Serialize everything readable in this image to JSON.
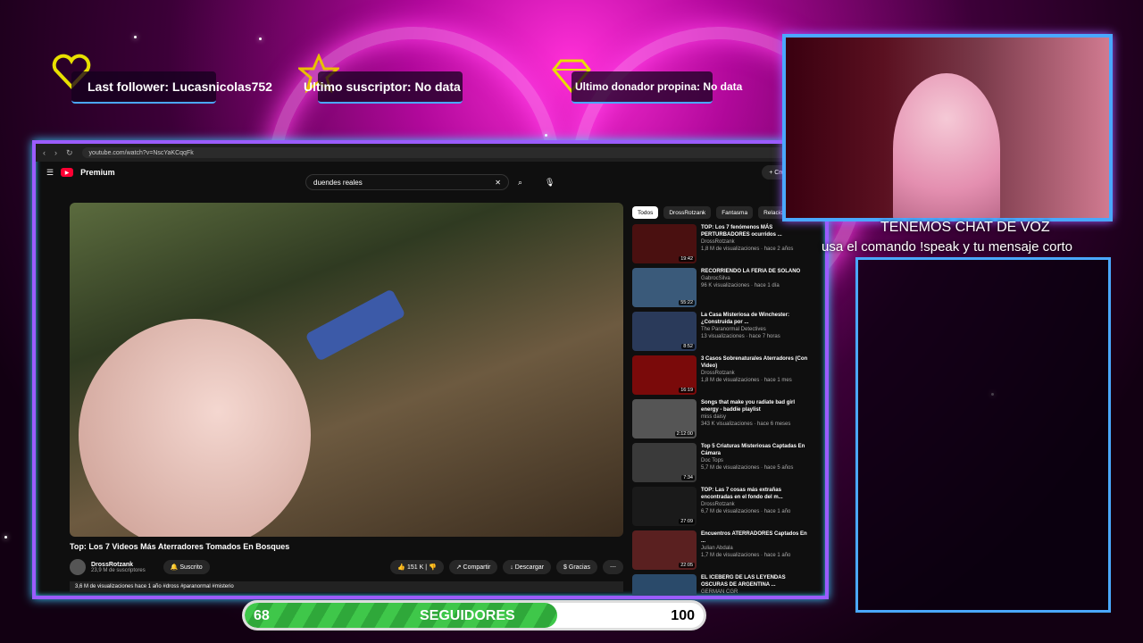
{
  "overlay": {
    "last_follower": "Last follower: Lucasnicolas752",
    "last_subscriber": "Ultimo suscriptor: No data",
    "last_donor": "Ultimo donador propina: No data",
    "voice_chat_title": "TENEMOS CHAT DE VOZ",
    "voice_chat_sub": "usa el comando !speak y tu mensaje corto",
    "followers_current": "68",
    "followers_label": "SEGUIDORES",
    "followers_goal": "100",
    "followers_progress": 0.68
  },
  "browser": {
    "url": "youtube.com/watch?v=NscYaKCqqFk",
    "create_label": "Crear"
  },
  "youtube": {
    "brand": "Premium",
    "search_value": "duendes reales",
    "video_title": "Top: Los 7 Videos Más Aterradores Tomados En Bosques",
    "channel": "DrossRotzank",
    "subscribers": "23,9 M de suscriptores",
    "subscribe_label": "Suscrito",
    "likes": "151 K",
    "share": "Compartir",
    "download": "Descargar",
    "thanks": "Gracias",
    "description": "3,6 M de visualizaciones  hace 1 año  #dross #paranormal #misterio",
    "chips": [
      "Todos",
      "DrossRotzank",
      "Fantasma",
      "Relacio"
    ],
    "recs": [
      {
        "title": "TOP: Los 7 fenómenos MÁS PERTURBADORES ocurridos ...",
        "channel": "DrossRotzank",
        "meta": "1,8 M de visualizaciones · hace 2 años",
        "dur": "19:42",
        "color": "#4a1010"
      },
      {
        "title": "RECORRIENDO LA FERIA DE SOLANO",
        "channel": "GabrocSilva",
        "meta": "96 K visualizaciones · hace 1 día",
        "dur": "55:22",
        "color": "#3a5a7a"
      },
      {
        "title": "La Casa Misteriosa de Winchester: ¿Construida por ...",
        "channel": "The Paranormal Detectives",
        "meta": "13 visualizaciones · hace 7 horas",
        "dur": "8:52",
        "color": "#2a3a5a"
      },
      {
        "title": "3 Casos Sobrenaturales Aterradores (Con Video)",
        "channel": "DrossRotzank",
        "meta": "1,8 M de visualizaciones · hace 1 mes",
        "dur": "16:19",
        "color": "#7a0a0a"
      },
      {
        "title": "Songs that make you radiate bad girl energy - baddie playlist",
        "channel": "miss daisy",
        "meta": "343 K visualizaciones · hace 6 meses",
        "dur": "2:12:00",
        "color": "#555"
      },
      {
        "title": "Top 5 Criaturas Misteriosas Captadas En Cámara",
        "channel": "Doc Tops",
        "meta": "5,7 M de visualizaciones · hace 5 años",
        "dur": "7:34",
        "color": "#3a3a3a"
      },
      {
        "title": "TOP: Las 7 cosas más extrañas encontradas en el fondo del m...",
        "channel": "DrossRotzank",
        "meta": "6,7 M de visualizaciones · hace 1 año",
        "dur": "27:09",
        "color": "#1a1a1a"
      },
      {
        "title": "Encuentros ATERRADORES Captados En ...",
        "channel": "Julian Abdala",
        "meta": "1,7 M de visualizaciones · hace 1 año",
        "dur": "22:05",
        "color": "#5a2020"
      },
      {
        "title": "EL ICEBERG DE LAS LEYENDAS OSCURAS DE ARGENTINA ...",
        "channel": "GERMAN CGR",
        "meta": "",
        "dur": "",
        "color": "#2a4a6a"
      }
    ]
  }
}
